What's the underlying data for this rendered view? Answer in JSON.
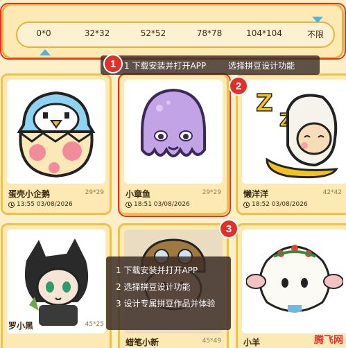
{
  "size_filter": {
    "ticks": [
      "0*0",
      "32*32",
      "52*52",
      "78*78",
      "104*104",
      "不限"
    ],
    "range_min_index": 0,
    "range_max_index": 5,
    "accent": "#4fb3e0"
  },
  "cards": [
    {
      "title": "蛋壳小企鹅",
      "size": "29*29",
      "time": "13:55 03/08/2026"
    },
    {
      "title": "小章鱼",
      "size": "29*29",
      "time": "18:51 03/08/2026"
    },
    {
      "title": "懒洋洋",
      "size": "42*42",
      "time": "18:52 03/08/2026"
    },
    {
      "title": "罗小黑",
      "size": "45*25",
      "time": ""
    },
    {
      "title": "蜡笔小新",
      "size": "45*49",
      "time": ""
    },
    {
      "title": "小羊",
      "size": "",
      "time": ""
    }
  ],
  "tooltip_top": {
    "step": "1 下载安装并打开APP",
    "next": "选择拼豆设计功能"
  },
  "tooltip_bottom": {
    "steps": [
      "1  下载安装并打开APP",
      "2  选择拼豆设计功能",
      "3  设计专属拼豆作品并体验"
    ]
  },
  "badges": [
    "1",
    "2",
    "3"
  ],
  "watermark": "腾飞网",
  "colors": {
    "highlight": "#e0302a",
    "card_border": "#f0c04a"
  }
}
